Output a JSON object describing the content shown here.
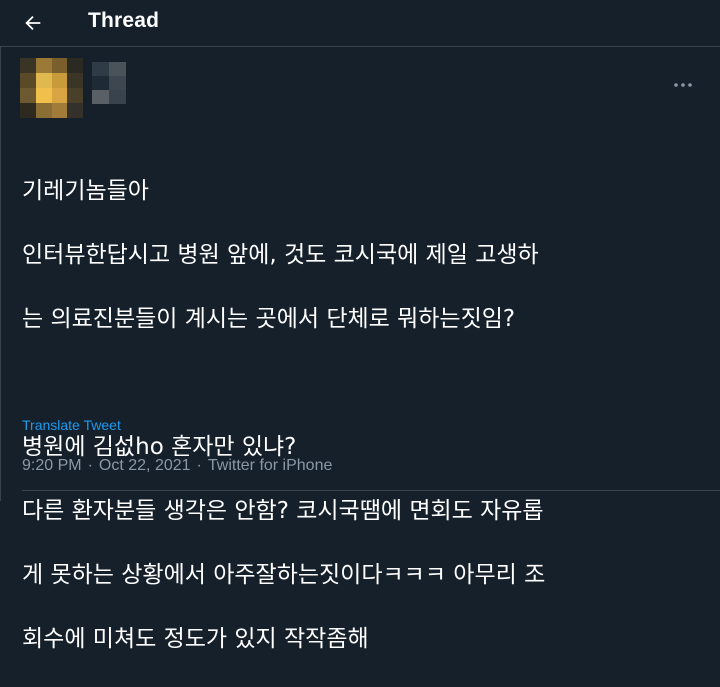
{
  "header": {
    "title": "Thread",
    "back_icon": "arrow-left-icon"
  },
  "author": {
    "avatar_blurred": true,
    "avatar_colors": [
      "#3a3424",
      "#9a7a36",
      "#7a5f2c",
      "#2a2a22",
      "#5a4a28",
      "#e0b850",
      "#c99a3a",
      "#3b3526",
      "#6e5a30",
      "#f0c04a",
      "#d8a542",
      "#4a402a",
      "#2e2a20",
      "#8a6e34",
      "#a07c38",
      "#34302a"
    ],
    "name_blurred": true,
    "name_colors": [
      "#2f3b46",
      "#4a525a",
      "#1e2a35",
      "#3e4750",
      "#5a5f66",
      "#38434d"
    ],
    "more_icon": "more-horizontal-icon"
  },
  "tweet": {
    "lines": [
      "기레기놈들아",
      "인터뷰한답시고 병원 앞에, 것도 코시국에 제일 고생하",
      "는 의료진분들이 계시는 곳에서 단체로 뭐하는짓임?",
      "",
      "병원에 김섮ho 혼자만 있냐?",
      "다른 환자분들 생각은 안함? 코시국땜에 면회도 자유롭",
      "게 못하는 상황에서 아주잘하는짓이다ㅋㅋㅋ 아무리 조",
      "회수에 미쳐도 정도가 있지 작작좀해"
    ],
    "translate_label": "Translate Tweet",
    "time": "9:20 PM",
    "date": "Oct 22, 2021",
    "source": "Twitter for iPhone",
    "separator": "·"
  },
  "colors": {
    "background": "#15202b",
    "divider": "#38444d",
    "accent": "#1d9bf0",
    "secondary_text": "#8b98a5"
  }
}
